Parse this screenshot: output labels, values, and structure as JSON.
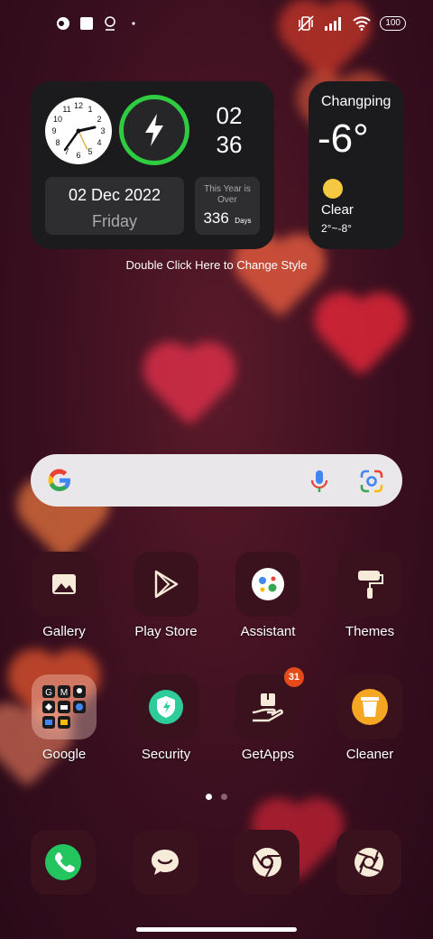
{
  "status_bar": {
    "left_icons": [
      "app-notification-icon",
      "square-notification-icon",
      "location-notification-icon",
      "more-dot-icon"
    ],
    "right_icons": [
      "vibrate-off-icon",
      "signal-icon",
      "wifi-icon"
    ],
    "battery": "100"
  },
  "clock_widget": {
    "hour": "02",
    "minute": "36",
    "date": "02 Dec 2022",
    "weekday": "Friday",
    "year_label": "This Year is Over",
    "days_count": "336",
    "days_unit": "Days",
    "accent_color": "#2ecc40"
  },
  "weather_widget": {
    "city": "Changping",
    "temperature": "-6°",
    "condition": "Clear",
    "range": "2°~-8°"
  },
  "hint": "Double Click Here to Change Style",
  "search": {
    "google_icon": "google-g-icon",
    "mic_icon": "mic-icon",
    "lens_icon": "lens-icon"
  },
  "apps": [
    {
      "label": "Gallery",
      "icon": "gallery-icon"
    },
    {
      "label": "Play Store",
      "icon": "play-store-icon"
    },
    {
      "label": "Assistant",
      "icon": "assistant-icon"
    },
    {
      "label": "Themes",
      "icon": "themes-icon"
    },
    {
      "label": "Google",
      "icon": "google-folder-icon"
    },
    {
      "label": "Security",
      "icon": "security-icon"
    },
    {
      "label": "GetApps",
      "icon": "getapps-icon",
      "badge": "31"
    },
    {
      "label": "Cleaner",
      "icon": "cleaner-icon"
    }
  ],
  "dock": [
    "phone-icon",
    "messages-icon",
    "chrome-icon",
    "camera-icon"
  ],
  "page_indicator": {
    "pages": 2,
    "current": 1
  }
}
